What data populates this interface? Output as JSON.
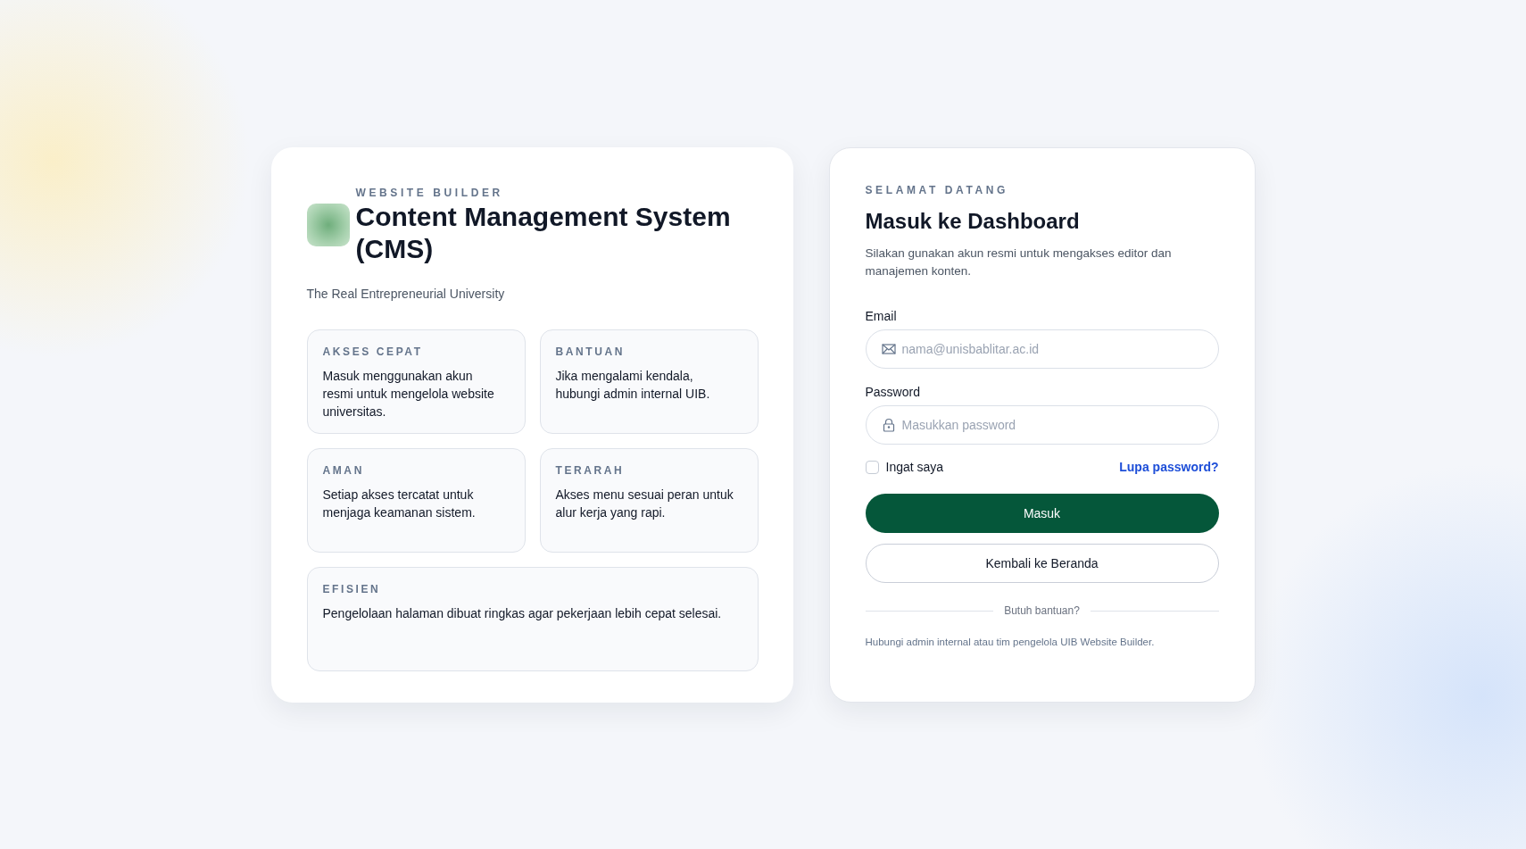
{
  "brand": {
    "eyebrow": "WEBSITE BUILDER",
    "title": "Content Management System (CMS)",
    "tagline": "The Real Entrepreneurial University"
  },
  "features": [
    {
      "heading": "AKSES CEPAT",
      "text": "Masuk menggunakan akun resmi untuk mengelola website universitas."
    },
    {
      "heading": "BANTUAN",
      "text": "Jika mengalami kendala, hubungi admin internal UIB."
    },
    {
      "heading": "AMAN",
      "text": "Setiap akses tercatat untuk menjaga keamanan sistem."
    },
    {
      "heading": "TERARAH",
      "text": "Akses menu sesuai peran untuk alur kerja yang rapi."
    },
    {
      "heading": "EFISIEN",
      "text": "Pengelolaan halaman dibuat ringkas agar pekerjaan lebih cepat selesai."
    }
  ],
  "login": {
    "eyebrow": "SELAMAT DATANG",
    "title": "Masuk ke Dashboard",
    "description": "Silakan gunakan akun resmi untuk mengakses editor dan manajemen konten.",
    "fields": [
      {
        "label": "Email",
        "placeholder": "nama@unisbablitar.ac.id",
        "kind": "email"
      },
      {
        "label": "Password",
        "placeholder": "Masukkan password",
        "kind": "password"
      }
    ],
    "remember": {
      "label": "Ingat saya",
      "checked": false
    },
    "forgot_link": "Lupa password?",
    "buttons": [
      {
        "label": "Masuk",
        "kind": "primary"
      },
      {
        "label": "Kembali ke Beranda",
        "kind": "secondary"
      }
    ],
    "divider_text": "Butuh bantuan?",
    "footer_note": "Hubungi admin internal atau tim pengelola UIB Website Builder."
  }
}
